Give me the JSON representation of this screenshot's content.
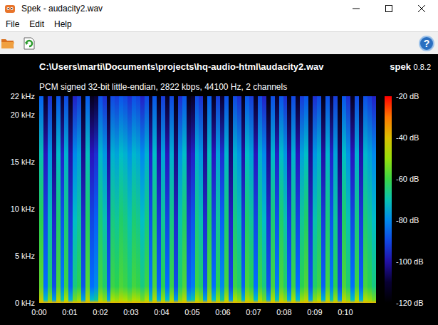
{
  "window": {
    "title": "Spek - audacity2.wav"
  },
  "menu": [
    "File",
    "Edit",
    "Help"
  ],
  "toolbar": {
    "help": "?"
  },
  "file": {
    "path": "C:\\Users\\marti\\Documents\\projects\\hq-audio-html\\audacity2.wav",
    "info": "PCM signed 32-bit little-endian, 2822 kbps, 44100 Hz, 2 channels"
  },
  "app": {
    "name": "spek",
    "version": "0.8.2"
  },
  "spectrogram": {
    "y_ticks": [
      {
        "label": "22 kHz",
        "khz": 22
      },
      {
        "label": "20 kHz",
        "khz": 20
      },
      {
        "label": "15 kHz",
        "khz": 15
      },
      {
        "label": "10 kHz",
        "khz": 10
      },
      {
        "label": "5 kHz",
        "khz": 5
      },
      {
        "label": "0 kHz",
        "khz": 0
      }
    ],
    "x_ticks": [
      {
        "label": "0:00",
        "seconds": 0
      },
      {
        "label": "0:01",
        "seconds": 1
      },
      {
        "label": "0:02",
        "seconds": 2
      },
      {
        "label": "0:03",
        "seconds": 3
      },
      {
        "label": "0:04",
        "seconds": 4
      },
      {
        "label": "0:05",
        "seconds": 5
      },
      {
        "label": "0:06",
        "seconds": 6
      },
      {
        "label": "0:07",
        "seconds": 7
      },
      {
        "label": "0:08",
        "seconds": 8
      },
      {
        "label": "0:09",
        "seconds": 9
      },
      {
        "label": "0:10",
        "seconds": 10
      }
    ],
    "duration_seconds": 10.98,
    "columns_db": [
      -62,
      -90,
      -70,
      -95,
      -64,
      -88,
      -66,
      -92,
      -72,
      -68,
      -94,
      -63,
      -90,
      -86,
      -65,
      -70,
      -93,
      -66,
      -68,
      -64,
      -66,
      -70,
      -65,
      -67,
      -72,
      -66,
      -88,
      -64,
      -92,
      -68,
      -90,
      -66,
      -95,
      -70,
      -64,
      -92,
      -88,
      -66,
      -70,
      -94,
      -63,
      -90,
      -68,
      -86,
      -65,
      -96,
      -66,
      -70,
      -92,
      -64,
      -68,
      -90,
      -66,
      -72,
      -94,
      -65,
      -88,
      -64,
      -70,
      -92,
      -66,
      -90,
      -68,
      -64,
      -94,
      -70,
      -66,
      -92,
      -65,
      -88,
      -68,
      -96,
      -64,
      -70,
      -90,
      -66,
      -92,
      -65,
      -68,
      -72
    ],
    "scale_ticks": [
      {
        "label": "-20 dB",
        "db": -20
      },
      {
        "label": "-40 dB",
        "db": -40
      },
      {
        "label": "-60 dB",
        "db": -60
      },
      {
        "label": "-80 dB",
        "db": -80
      },
      {
        "label": "-100 dB",
        "db": -100
      },
      {
        "label": "-120 dB",
        "db": -120
      }
    ]
  }
}
